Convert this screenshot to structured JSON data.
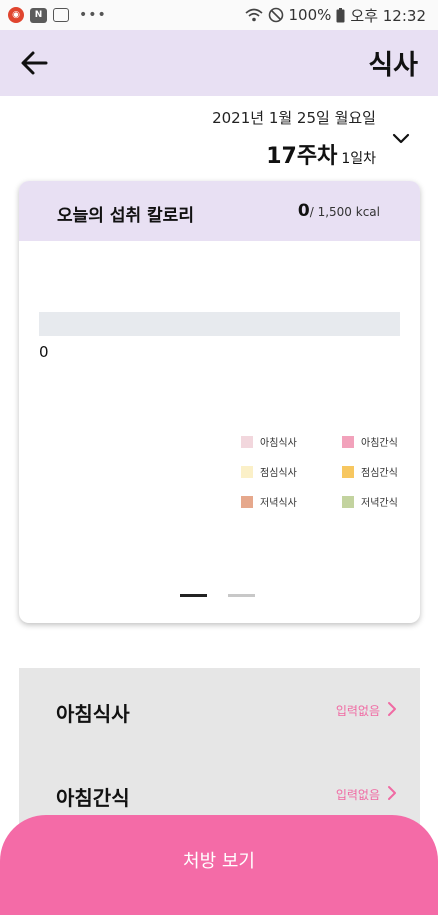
{
  "status_bar": {
    "battery": "100%",
    "time": "오후 12:32",
    "icons": [
      "opera-app-icon",
      "naver-app-icon",
      "message-app-icon",
      "more-notifications-icon",
      "wifi-icon",
      "do-not-disturb-icon",
      "battery-icon"
    ]
  },
  "header": {
    "title": "식사",
    "back_icon": "arrow-left-icon"
  },
  "date": {
    "full": "2021년 1월 25일 월요일",
    "week": "17주차",
    "day": "1일차",
    "toggle_icon": "chevron-down-icon"
  },
  "calorie_card": {
    "title": "오늘의 섭취 칼로리",
    "current": "0",
    "total": "/ 1,500 kcal",
    "bar_value": 0,
    "bar_label": "0",
    "legend": [
      {
        "label": "아침식사",
        "color": "#f2d7dd"
      },
      {
        "label": "아침간식",
        "color": "#f2a2bb"
      },
      {
        "label": "점심식사",
        "color": "#fbf0c8"
      },
      {
        "label": "점심간식",
        "color": "#f7c760"
      },
      {
        "label": "저녁식사",
        "color": "#e6a88c"
      },
      {
        "label": "저녁간식",
        "color": "#c3d39f"
      }
    ],
    "page_indicator": {
      "current": 1,
      "total": 2
    }
  },
  "meals": [
    {
      "name": "아침식사",
      "status": "입력없음"
    },
    {
      "name": "아침간식",
      "status": "입력없음"
    }
  ],
  "cta": {
    "label": "처방 보기"
  },
  "colors": {
    "accent_pink": "#f46ba7",
    "header_lavender": "#e8e0f3",
    "track_gray": "#e7eaee",
    "divider_blue": "#8ed0e8"
  }
}
